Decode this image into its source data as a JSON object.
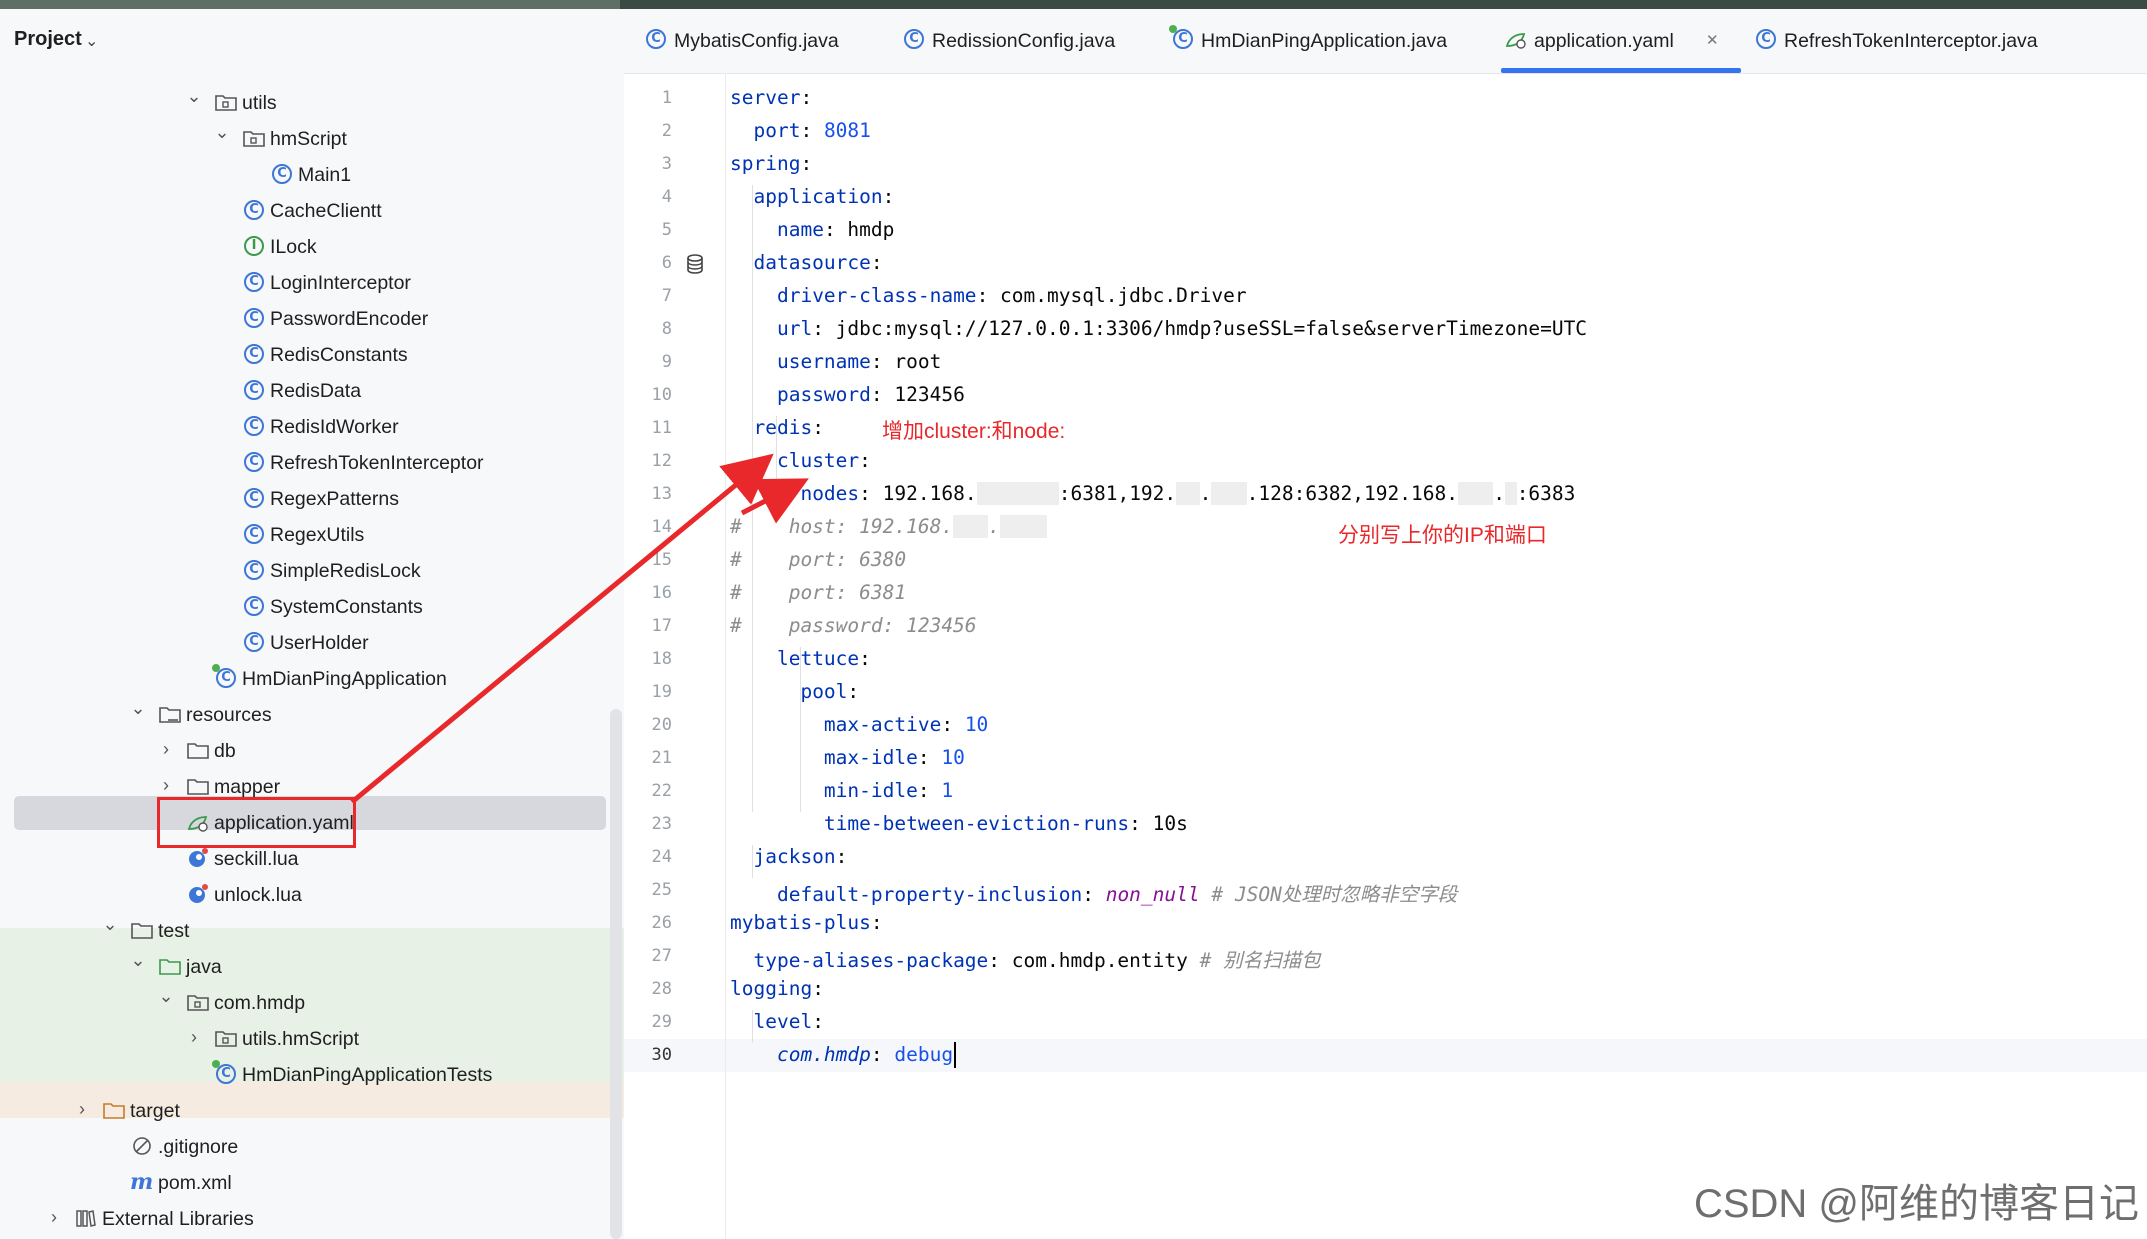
{
  "project_panel": {
    "title": "Project",
    "tree": [
      {
        "label": "utils",
        "icon": "package-folder-icon",
        "chevron": "v",
        "indent": 1
      },
      {
        "label": "hmScript",
        "icon": "package-folder-icon",
        "chevron": "v",
        "indent": 2
      },
      {
        "label": "Main1",
        "icon": "class-icon",
        "chevron": "",
        "indent": 3
      },
      {
        "label": "CacheClientt",
        "icon": "class-icon",
        "chevron": "",
        "indent": 2
      },
      {
        "label": "ILock",
        "icon": "interface-icon",
        "chevron": "",
        "indent": 2
      },
      {
        "label": "LoginInterceptor",
        "icon": "class-icon",
        "chevron": "",
        "indent": 2
      },
      {
        "label": "PasswordEncoder",
        "icon": "class-icon",
        "chevron": "",
        "indent": 2
      },
      {
        "label": "RedisConstants",
        "icon": "class-icon",
        "chevron": "",
        "indent": 2
      },
      {
        "label": "RedisData",
        "icon": "class-icon",
        "chevron": "",
        "indent": 2
      },
      {
        "label": "RedisIdWorker",
        "icon": "class-icon",
        "chevron": "",
        "indent": 2
      },
      {
        "label": "RefreshTokenInterceptor",
        "icon": "class-icon",
        "chevron": "",
        "indent": 2
      },
      {
        "label": "RegexPatterns",
        "icon": "class-icon",
        "chevron": "",
        "indent": 2
      },
      {
        "label": "RegexUtils",
        "icon": "class-icon",
        "chevron": "",
        "indent": 2
      },
      {
        "label": "SimpleRedisLock",
        "icon": "class-icon",
        "chevron": "",
        "indent": 2
      },
      {
        "label": "SystemConstants",
        "icon": "class-icon",
        "chevron": "",
        "indent": 2
      },
      {
        "label": "UserHolder",
        "icon": "class-icon",
        "chevron": "",
        "indent": 2
      },
      {
        "label": "HmDianPingApplication",
        "icon": "spring-class-icon",
        "chevron": "",
        "indent": 1
      },
      {
        "label": "resources",
        "icon": "resources-folder-icon",
        "chevron": "v",
        "indent": -1
      },
      {
        "label": "db",
        "icon": "folder-icon",
        "chevron": ">",
        "indent": 0
      },
      {
        "label": "mapper",
        "icon": "folder-icon",
        "chevron": ">",
        "indent": 0
      },
      {
        "label": "application.yaml",
        "icon": "yaml-icon",
        "chevron": "",
        "indent": 0
      },
      {
        "label": "seckill.lua",
        "icon": "lua-icon",
        "chevron": "",
        "indent": 0
      },
      {
        "label": "unlock.lua",
        "icon": "lua-icon",
        "chevron": "",
        "indent": 0
      },
      {
        "label": "test",
        "icon": "folder-icon",
        "chevron": "v",
        "indent": -2
      },
      {
        "label": "java",
        "icon": "test-folder-icon",
        "chevron": "v",
        "indent": -1
      },
      {
        "label": "com.hmdp",
        "icon": "package-folder-icon",
        "chevron": "v",
        "indent": 0
      },
      {
        "label": "utils.hmScript",
        "icon": "package-folder-icon",
        "chevron": ">",
        "indent": 1
      },
      {
        "label": "HmDianPingApplicationTests",
        "icon": "spring-class-icon",
        "chevron": "",
        "indent": 1
      },
      {
        "label": "target",
        "icon": "excluded-folder-icon",
        "chevron": ">",
        "indent": -3
      },
      {
        "label": ".gitignore",
        "icon": "ignore-file-icon",
        "chevron": "",
        "indent": -2
      },
      {
        "label": "pom.xml",
        "icon": "maven-icon",
        "chevron": "",
        "indent": -2
      },
      {
        "label": "External Libraries",
        "icon": "library-icon",
        "chevron": ">",
        "indent": -4
      }
    ]
  },
  "tabs": [
    {
      "label": "MybatisConfig.java",
      "icon": "class-icon",
      "active": false
    },
    {
      "label": "RedissionConfig.java",
      "icon": "class-icon",
      "active": false
    },
    {
      "label": "HmDianPingApplication.java",
      "icon": "spring-class-icon",
      "active": false
    },
    {
      "label": "application.yaml",
      "icon": "yaml-icon",
      "active": true
    },
    {
      "label": "RefreshTokenInterceptor.java",
      "icon": "class-icon",
      "active": false
    }
  ],
  "editor": {
    "current_line": 30,
    "lines": [
      {
        "n": "1",
        "seg": [
          [
            "k",
            "server"
          ],
          [
            "p",
            ":"
          ]
        ]
      },
      {
        "n": "2",
        "seg": [
          [
            "p",
            "  "
          ],
          [
            "k",
            "port"
          ],
          [
            "p",
            ": "
          ],
          [
            "n",
            "8081"
          ]
        ]
      },
      {
        "n": "3",
        "seg": [
          [
            "k",
            "spring"
          ],
          [
            "p",
            ":"
          ]
        ]
      },
      {
        "n": "4",
        "seg": [
          [
            "p",
            "  "
          ],
          [
            "k",
            "application"
          ],
          [
            "p",
            ":"
          ]
        ]
      },
      {
        "n": "5",
        "seg": [
          [
            "p",
            "    "
          ],
          [
            "k",
            "name"
          ],
          [
            "p",
            ": hmdp"
          ]
        ]
      },
      {
        "n": "6",
        "seg": [
          [
            "p",
            "  "
          ],
          [
            "k",
            "datasource"
          ],
          [
            "p",
            ":"
          ]
        ]
      },
      {
        "n": "7",
        "seg": [
          [
            "p",
            "    "
          ],
          [
            "k",
            "driver-class-name"
          ],
          [
            "p",
            ": com.mysql.jdbc.Driver"
          ]
        ]
      },
      {
        "n": "8",
        "seg": [
          [
            "p",
            "    "
          ],
          [
            "k",
            "url"
          ],
          [
            "p",
            ": jdbc:mysql://127.0.0.1:3306/hmdp?useSSL=false&serverTimezone=UTC"
          ]
        ]
      },
      {
        "n": "9",
        "seg": [
          [
            "p",
            "    "
          ],
          [
            "k",
            "username"
          ],
          [
            "p",
            ": root"
          ]
        ]
      },
      {
        "n": "10",
        "seg": [
          [
            "p",
            "    "
          ],
          [
            "k",
            "password"
          ],
          [
            "p",
            ": 123456"
          ]
        ]
      },
      {
        "n": "11",
        "seg": [
          [
            "p",
            "  "
          ],
          [
            "k",
            "redis"
          ],
          [
            "p",
            ":"
          ]
        ]
      },
      {
        "n": "12",
        "seg": [
          [
            "p",
            "    "
          ],
          [
            "k",
            "cluster"
          ],
          [
            "p",
            ":"
          ]
        ]
      },
      {
        "n": "13",
        "seg": [
          [
            "p",
            "      "
          ],
          [
            "k",
            "nodes"
          ],
          [
            "p",
            ": 192.168."
          ],
          [
            "m",
            "xxx.xxx"
          ],
          [
            "p",
            ":6381,192."
          ],
          [
            "m",
            "xx"
          ],
          [
            "p",
            "."
          ],
          [
            "m",
            "xxx"
          ],
          [
            "p",
            ".128:6382,192.168."
          ],
          [
            "m",
            "xxx"
          ],
          [
            "p",
            "."
          ],
          [
            "m",
            "x"
          ],
          [
            "p",
            ":6383"
          ]
        ]
      },
      {
        "n": "14",
        "seg": [
          [
            "c",
            "#    host: 192.168."
          ],
          [
            "m",
            "xxx"
          ],
          [
            "c",
            "."
          ],
          [
            "m",
            "xxxx"
          ]
        ]
      },
      {
        "n": "15",
        "seg": [
          [
            "c",
            "#    port: 6380"
          ]
        ]
      },
      {
        "n": "16",
        "seg": [
          [
            "c",
            "#    port: 6381"
          ]
        ]
      },
      {
        "n": "17",
        "seg": [
          [
            "c",
            "#    password: 123456"
          ]
        ]
      },
      {
        "n": "18",
        "seg": [
          [
            "p",
            "    "
          ],
          [
            "k",
            "lettuce"
          ],
          [
            "p",
            ":"
          ]
        ]
      },
      {
        "n": "19",
        "seg": [
          [
            "p",
            "      "
          ],
          [
            "k",
            "pool"
          ],
          [
            "p",
            ":"
          ]
        ]
      },
      {
        "n": "20",
        "seg": [
          [
            "p",
            "        "
          ],
          [
            "k",
            "max-active"
          ],
          [
            "p",
            ": "
          ],
          [
            "n",
            "10"
          ]
        ]
      },
      {
        "n": "21",
        "seg": [
          [
            "p",
            "        "
          ],
          [
            "k",
            "max-idle"
          ],
          [
            "p",
            ": "
          ],
          [
            "n",
            "10"
          ]
        ]
      },
      {
        "n": "22",
        "seg": [
          [
            "p",
            "        "
          ],
          [
            "k",
            "min-idle"
          ],
          [
            "p",
            ": "
          ],
          [
            "n",
            "1"
          ]
        ]
      },
      {
        "n": "23",
        "seg": [
          [
            "p",
            "        "
          ],
          [
            "k",
            "time-between-eviction-runs"
          ],
          [
            "p",
            ": 10s"
          ]
        ]
      },
      {
        "n": "24",
        "seg": [
          [
            "p",
            "  "
          ],
          [
            "k",
            "jackson"
          ],
          [
            "p",
            ":"
          ]
        ]
      },
      {
        "n": "25",
        "seg": [
          [
            "p",
            "    "
          ],
          [
            "k",
            "default-property-inclusion"
          ],
          [
            "p",
            ": "
          ],
          [
            "iv",
            "non_null"
          ],
          [
            "c",
            " # JSON处理时忽略非空字段"
          ]
        ]
      },
      {
        "n": "26",
        "seg": [
          [
            "k",
            "mybatis-plus"
          ],
          [
            "p",
            ":"
          ]
        ]
      },
      {
        "n": "27",
        "seg": [
          [
            "p",
            "  "
          ],
          [
            "k",
            "type-aliases-package"
          ],
          [
            "p",
            ": com.hmdp.entity "
          ],
          [
            "c",
            "# 别名扫描包"
          ]
        ]
      },
      {
        "n": "28",
        "seg": [
          [
            "k",
            "logging"
          ],
          [
            "p",
            ":"
          ]
        ]
      },
      {
        "n": "29",
        "seg": [
          [
            "p",
            "  "
          ],
          [
            "k",
            "level"
          ],
          [
            "p",
            ":"
          ]
        ]
      },
      {
        "n": "30",
        "seg": [
          [
            "p",
            "    "
          ],
          [
            "ck",
            "com.hmdp"
          ],
          [
            "p",
            ": "
          ],
          [
            "n",
            "debug"
          ]
        ]
      }
    ]
  },
  "annotations": {
    "add_cluster": "增加cluster:和node:",
    "fill_ip_port": "分别写上你的IP和端口"
  },
  "watermark": "CSDN @阿维的博客日记",
  "colors": {
    "accent": "#3574f0",
    "annotation": "#e8282a",
    "key": "#0033b3",
    "number": "#1750eb"
  }
}
